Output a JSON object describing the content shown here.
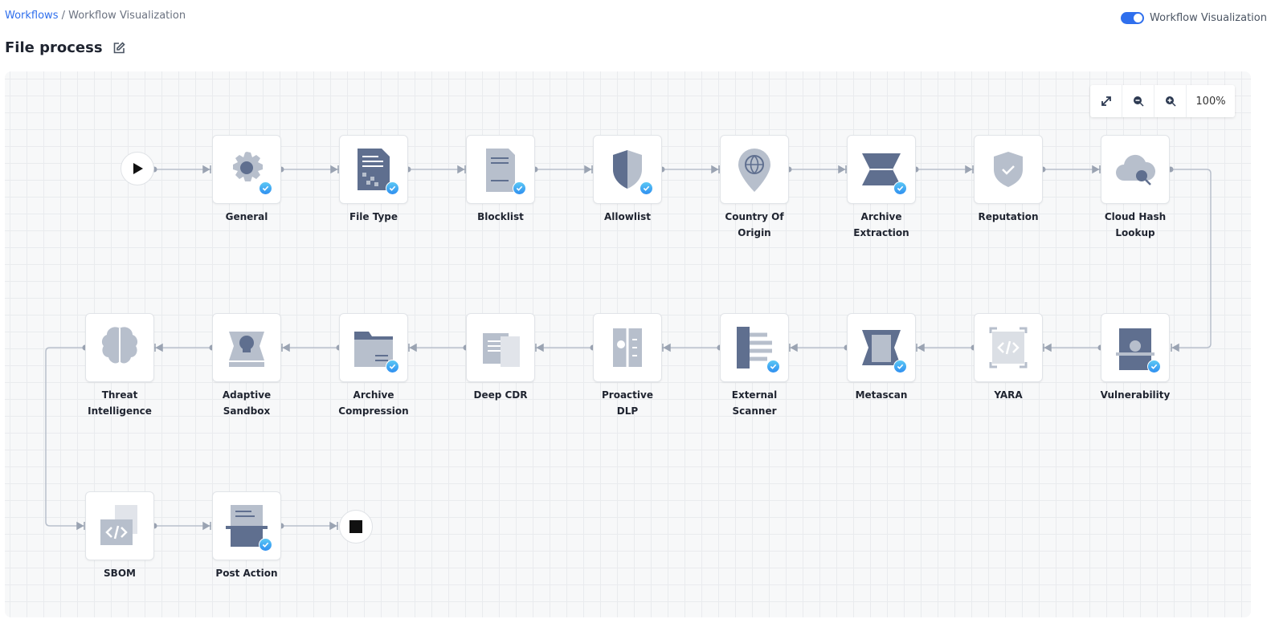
{
  "breadcrumb": {
    "root": "Workflows",
    "separator": " / ",
    "current": "Workflow Visualization"
  },
  "page": {
    "title": "File process"
  },
  "toggle": {
    "label": "Workflow Visualization",
    "on": true
  },
  "zoom": {
    "level": "100%"
  },
  "colors": {
    "accent": "#2f6fed",
    "icon": "#5f6f8f",
    "check": "#3aa6f2"
  },
  "nodes": [
    {
      "label": "General",
      "icon": "gear-icon",
      "checked": true
    },
    {
      "label": "File Type",
      "icon": "file-type-icon",
      "checked": true
    },
    {
      "label": "Blocklist",
      "icon": "blocklist-icon",
      "checked": true
    },
    {
      "label": "Allowlist",
      "icon": "shield-icon",
      "checked": true
    },
    {
      "label": "Country Of Origin",
      "icon": "globe-pin-icon",
      "checked": false
    },
    {
      "label": "Archive Extraction",
      "icon": "archive-extraction-icon",
      "checked": true
    },
    {
      "label": "Reputation",
      "icon": "shield-check-icon",
      "checked": false
    },
    {
      "label": "Cloud Hash Lookup",
      "icon": "cloud-search-icon",
      "checked": false
    },
    {
      "label": "Vulnerability",
      "icon": "vulnerability-icon",
      "checked": true
    },
    {
      "label": "YARA",
      "icon": "code-icon",
      "checked": false
    },
    {
      "label": "Metascan",
      "icon": "metascan-icon",
      "checked": true
    },
    {
      "label": "External Scanner",
      "icon": "external-scanner-icon",
      "checked": true
    },
    {
      "label": "Proactive DLP",
      "icon": "dlp-icon",
      "checked": false
    },
    {
      "label": "Deep CDR",
      "icon": "cdr-icon",
      "checked": false
    },
    {
      "label": "Archive Compression",
      "icon": "folder-icon",
      "checked": true
    },
    {
      "label": "Adaptive Sandbox",
      "icon": "skull-icon",
      "checked": false
    },
    {
      "label": "Threat Intelligence",
      "icon": "brain-icon",
      "checked": false
    },
    {
      "label": "SBOM",
      "icon": "sbom-icon",
      "checked": false
    },
    {
      "label": "Post Action",
      "icon": "post-action-icon",
      "checked": true
    }
  ]
}
